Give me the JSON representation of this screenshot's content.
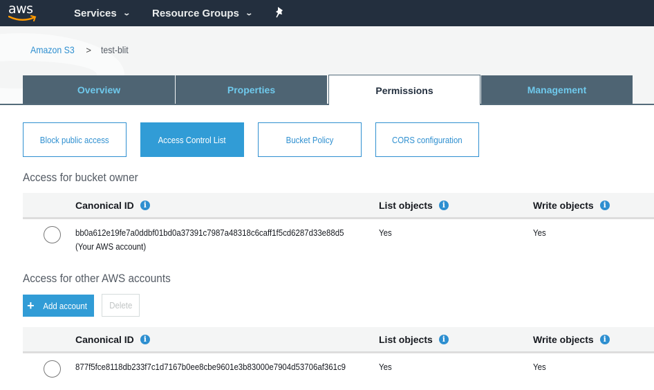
{
  "topnav": {
    "logo_text": "aws",
    "services_label": "Services",
    "resource_groups_label": "Resource Groups",
    "pin_icon": "pushpin-icon"
  },
  "breadcrumb": {
    "root": "Amazon S3",
    "separator": ">",
    "current": "test-blit"
  },
  "tabs": [
    {
      "label": "Overview",
      "active": false
    },
    {
      "label": "Properties",
      "active": false
    },
    {
      "label": "Permissions",
      "active": true
    },
    {
      "label": "Management",
      "active": false
    }
  ],
  "subtabs": [
    {
      "label": "Block public access",
      "active": false
    },
    {
      "label": "Access Control List",
      "active": true
    },
    {
      "label": "Bucket Policy",
      "active": false
    },
    {
      "label": "CORS configuration",
      "active": false
    }
  ],
  "owner_section": {
    "title": "Access for bucket owner",
    "columns": [
      "Canonical ID",
      "List objects",
      "Write objects"
    ],
    "rows": [
      {
        "canonical_id": "bb0a612e19fe7a0ddbf01bd0a37391c7987a48318c6caff1f5cd6287d33e88d5",
        "note": "(Your AWS account)",
        "list_objects": "Yes",
        "write_objects": "Yes"
      }
    ]
  },
  "other_section": {
    "title": "Access for other AWS accounts",
    "add_button": "Add account",
    "delete_button": "Delete",
    "columns": [
      "Canonical ID",
      "List objects",
      "Write objects"
    ],
    "rows": [
      {
        "canonical_id": "877f5fce8118db233f7c1d7167b0ee8cbe9601e3b83000e7904d53706af361c9",
        "list_objects": "Yes",
        "write_objects": "Yes"
      }
    ]
  },
  "colors": {
    "nav_bg": "#232f3e",
    "tab_bg": "#4e6473",
    "tab_text": "#6fc9ec",
    "accent": "#319cd6",
    "link": "#2e8fd0",
    "logo_smile": "#ff9900"
  }
}
